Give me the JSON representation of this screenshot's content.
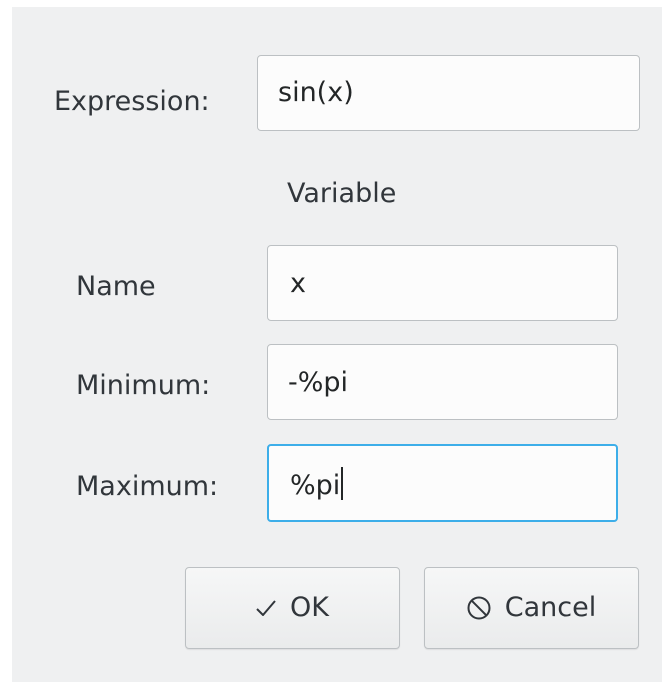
{
  "form": {
    "expression_label": "Expression:",
    "expression_value": "sin(x)",
    "variable_heading": "Variable",
    "name_label": "Name",
    "name_value": "x",
    "minimum_label": "Minimum:",
    "minimum_value": "-%pi",
    "maximum_label": "Maximum:",
    "maximum_value": "%pi"
  },
  "buttons": {
    "ok_label": "OK",
    "ok_icon": "checkmark-icon",
    "cancel_label": "Cancel",
    "cancel_icon": "cancel-icon"
  },
  "colors": {
    "dialog_background": "#eff0f1",
    "field_background": "#fcfcfc",
    "focus_accent": "#3daee9",
    "border": "#bcc0c3"
  }
}
